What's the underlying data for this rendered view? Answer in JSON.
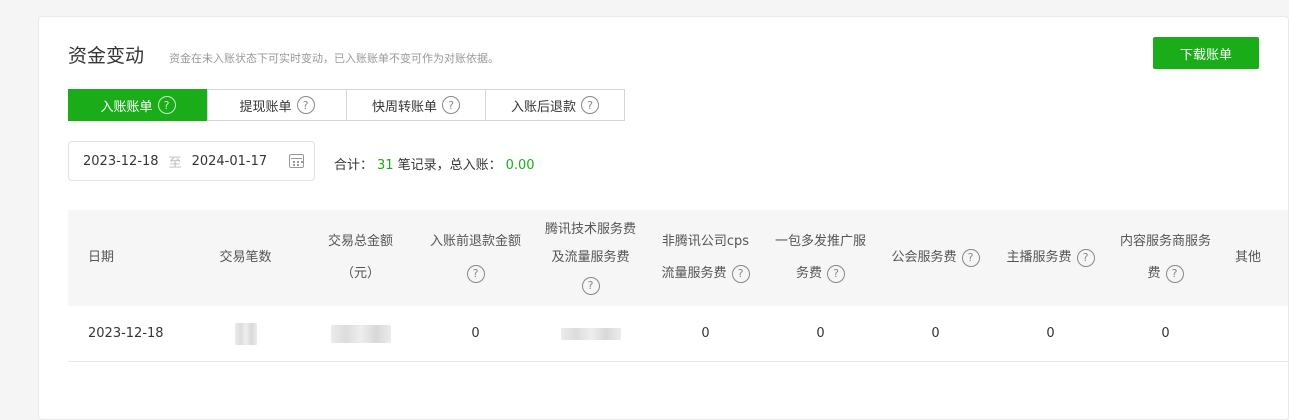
{
  "header": {
    "title": "资金变动",
    "subtitle": "资金在未入账状态下可实时变动，已入账账单不变可作为对账依据。",
    "download_label": "下载账单"
  },
  "tabs": [
    {
      "label": "入账账单",
      "active": true
    },
    {
      "label": "提现账单",
      "active": false
    },
    {
      "label": "快周转账单",
      "active": false
    },
    {
      "label": "入账后退款",
      "active": false
    }
  ],
  "help_glyph": "?",
  "date_range": {
    "start": "2023-12-18",
    "sep": "至",
    "end": "2024-01-17"
  },
  "summary": {
    "prefix": "合计：",
    "count": "31",
    "middle": "笔记录，总入账：",
    "total": "0.00"
  },
  "table": {
    "headers": [
      {
        "lines": [
          "日期"
        ]
      },
      {
        "lines": [
          "交易笔数"
        ]
      },
      {
        "lines": [
          "交易总金额",
          "（元）"
        ]
      },
      {
        "lines": [
          "入账前退款金额"
        ],
        "help": true
      },
      {
        "lines": [
          "腾讯技术服务费",
          "及流量服务费"
        ],
        "help": true
      },
      {
        "lines": [
          "非腾讯公司cps",
          "流量服务费"
        ],
        "help": true
      },
      {
        "lines": [
          "一包多发推广服",
          "务费"
        ],
        "help": true
      },
      {
        "lines": [
          "公会服务费"
        ],
        "help": true
      },
      {
        "lines": [
          "主播服务费"
        ],
        "help": true
      },
      {
        "lines": [
          "内容服务商服务",
          "费"
        ],
        "help": true
      },
      {
        "lines": [
          "其他"
        ]
      }
    ],
    "rows": [
      {
        "date": "2023-12-18",
        "v3": "0",
        "v5": "0",
        "v6": "0",
        "v7": "0",
        "v8": "0",
        "v9": "0"
      }
    ]
  },
  "colors": {
    "accent": "#1aad19"
  }
}
